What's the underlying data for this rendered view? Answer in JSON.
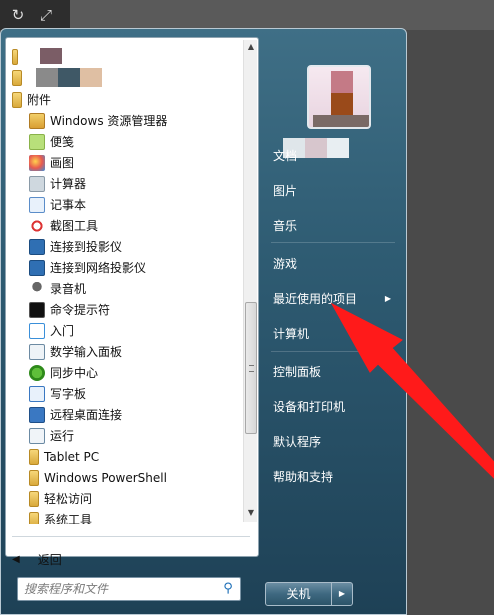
{
  "programs": [
    {
      "label": "",
      "icon": "folder-icon",
      "kind": "pixelated-folder-1"
    },
    {
      "label": "",
      "icon": "folder-icon",
      "kind": "pixelated-folder-2"
    },
    {
      "label": "附件",
      "icon": "folder-icon"
    },
    {
      "label": "Windows 资源管理器",
      "icon": "explorer-icon"
    },
    {
      "label": "便笺",
      "icon": "sticky-notes-icon"
    },
    {
      "label": "画图",
      "icon": "paint-icon"
    },
    {
      "label": "计算器",
      "icon": "calculator-icon"
    },
    {
      "label": "记事本",
      "icon": "notepad-icon"
    },
    {
      "label": "截图工具",
      "icon": "snipping-tool-icon"
    },
    {
      "label": "连接到投影仪",
      "icon": "projector-icon"
    },
    {
      "label": "连接到网络投影仪",
      "icon": "network-projector-icon"
    },
    {
      "label": "录音机",
      "icon": "microphone-icon"
    },
    {
      "label": "命令提示符",
      "icon": "command-prompt-icon"
    },
    {
      "label": "入门",
      "icon": "getting-started-icon"
    },
    {
      "label": "数学输入面板",
      "icon": "math-input-icon"
    },
    {
      "label": "同步中心",
      "icon": "sync-center-icon"
    },
    {
      "label": "写字板",
      "icon": "wordpad-icon"
    },
    {
      "label": "远程桌面连接",
      "icon": "remote-desktop-icon"
    },
    {
      "label": "运行",
      "icon": "run-icon"
    },
    {
      "label": "Tablet PC",
      "icon": "folder-icon"
    },
    {
      "label": "Windows PowerShell",
      "icon": "folder-icon"
    },
    {
      "label": "轻松访问",
      "icon": "folder-icon"
    },
    {
      "label": "系统工具",
      "icon": "folder-icon"
    }
  ],
  "back_label": "返回",
  "search": {
    "placeholder": "搜索程序和文件"
  },
  "right_items": [
    {
      "label": "文档",
      "has_submenu": false
    },
    {
      "label": "图片",
      "has_submenu": false
    },
    {
      "label": "音乐",
      "has_submenu": false
    },
    {
      "label": "游戏",
      "has_submenu": false
    },
    {
      "label": "最近使用的项目",
      "has_submenu": true
    },
    {
      "label": "计算机",
      "has_submenu": false
    },
    {
      "label": "控制面板",
      "has_submenu": false
    },
    {
      "label": "设备和打印机",
      "has_submenu": false
    },
    {
      "label": "默认程序",
      "has_submenu": false
    },
    {
      "label": "帮助和支持",
      "has_submenu": false
    }
  ],
  "shutdown_label": "关机",
  "colors": {
    "accent_arrow": "#ff1a1a",
    "menu_glass": "#2e5b72"
  }
}
